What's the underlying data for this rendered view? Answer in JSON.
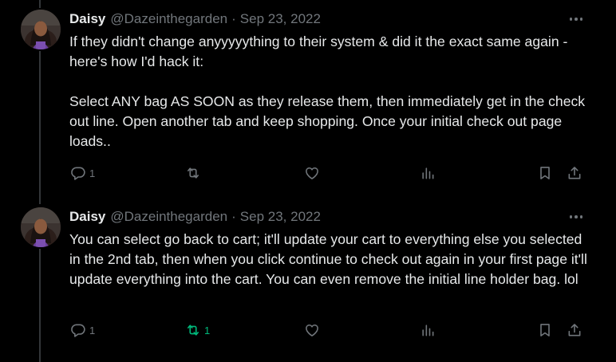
{
  "tweets": [
    {
      "name": "Daisy",
      "handle": "@Dazeinthegarden",
      "separator": "·",
      "date": "Sep 23, 2022",
      "paragraphs": [
        "If they didn't change anyyyyything to their system & did it the exact same again - here's how I'd hack it:",
        "Select ANY bag AS SOON as they release them, then immediately get in the check out line. Open another tab and keep shopping. Once your initial check out page loads.."
      ],
      "reply_count": "1",
      "retweet_count": "",
      "retweeted": false,
      "like_count": "",
      "views_count": ""
    },
    {
      "name": "Daisy",
      "handle": "@Dazeinthegarden",
      "separator": "·",
      "date": "Sep 23, 2022",
      "paragraphs": [
        "You can select go back to cart; it'll update your cart to everything else you selected in the 2nd tab, then when you click continue to check out again in your first page it'll update everything into the cart. You can even remove the initial line holder bag. lol"
      ],
      "reply_count": "1",
      "retweet_count": "1",
      "retweeted": true,
      "like_count": "",
      "views_count": ""
    }
  ],
  "colors": {
    "background": "#000000",
    "text": "#e7e9ea",
    "muted": "#71767b",
    "retweet_active": "#00ba7c",
    "thread_line": "#333639"
  },
  "icons": [
    "reply-icon",
    "retweet-icon",
    "like-icon",
    "views-icon",
    "bookmark-icon",
    "share-icon",
    "more-icon"
  ]
}
